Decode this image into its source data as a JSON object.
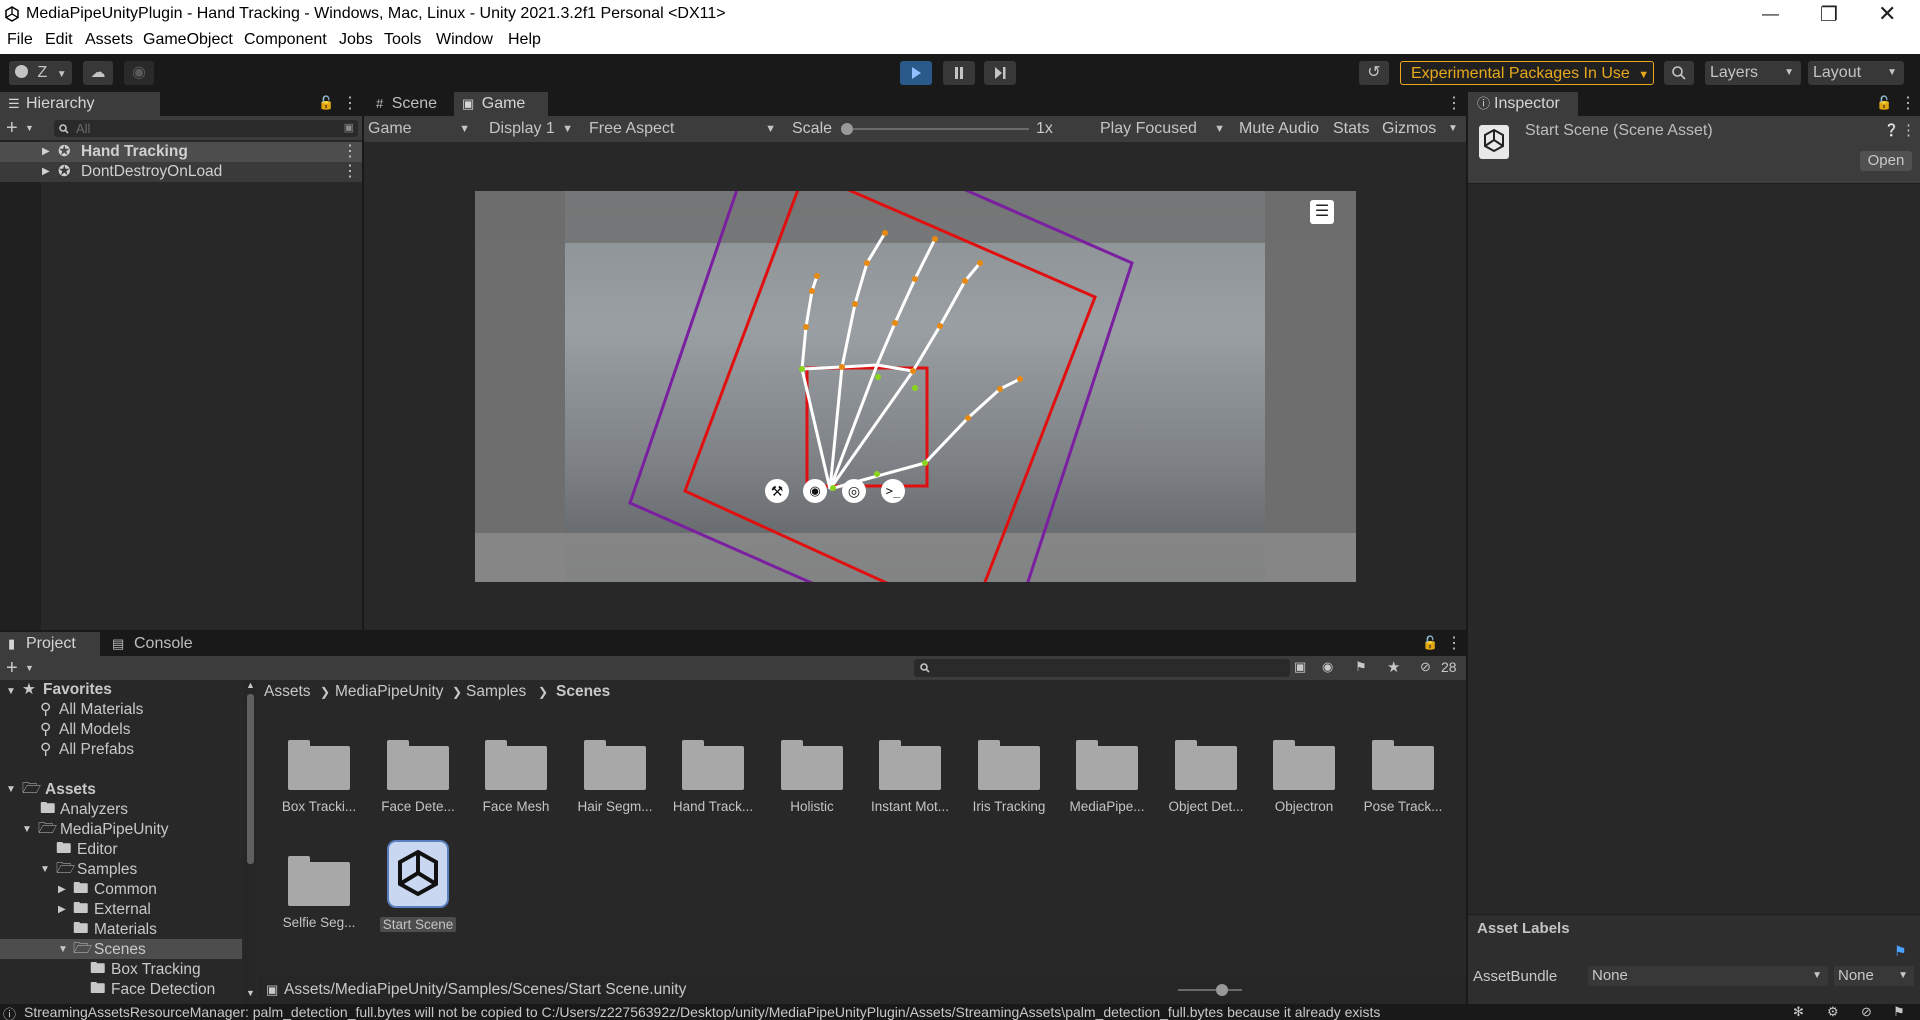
{
  "window": {
    "title": "MediaPipeUnityPlugin - Hand Tracking - Windows, Mac, Linux - Unity 2021.3.2f1 Personal <DX11>"
  },
  "menu": [
    "File",
    "Edit",
    "Assets",
    "GameObject",
    "Component",
    "Jobs",
    "Tools",
    "Window",
    "Help"
  ],
  "toolbar": {
    "account": "Z",
    "experimental": "Experimental Packages In Use",
    "layers": "Layers",
    "layout": "Layout"
  },
  "hierarchy": {
    "tab": "Hierarchy",
    "search_placeholder": "All",
    "items": [
      "Hand Tracking",
      "DontDestroyOnLoad"
    ]
  },
  "game": {
    "tabs": [
      "Scene",
      "Game"
    ],
    "mode": "Game",
    "display": "Display 1",
    "aspect": "Free Aspect",
    "scale_label": "Scale",
    "scale_value": "1x",
    "play_focused": "Play Focused",
    "mute": "Mute Audio",
    "stats": "Stats",
    "gizmos": "Gizmos"
  },
  "inspector": {
    "tab": "Inspector",
    "asset": "Start Scene (Scene Asset)",
    "open": "Open",
    "asset_labels": "Asset Labels",
    "bundle_label": "AssetBundle",
    "bundle_value": "None",
    "variant_value": "None"
  },
  "project": {
    "tabs": [
      "Project",
      "Console"
    ],
    "hidden_count": "28",
    "favorites": "Favorites",
    "favorite_items": [
      "All Materials",
      "All Models",
      "All Prefabs"
    ],
    "assets_root": "Assets",
    "tree": [
      "Analyzers",
      "MediaPipeUnity",
      "Editor",
      "Samples",
      "Common",
      "External",
      "Materials",
      "Scenes",
      "Box Tracking",
      "Face Detection"
    ],
    "breadcrumb": [
      "Assets",
      "MediaPipeUnity",
      "Samples",
      "Scenes"
    ],
    "folders": [
      "Box Tracki...",
      "Face Dete...",
      "Face Mesh",
      "Hair Segm...",
      "Hand Track...",
      "Holistic",
      "Instant Mot...",
      "Iris Tracking",
      "MediaPipe...",
      "Object Det...",
      "Objectron",
      "Pose Track...",
      "Selfie Seg..."
    ],
    "selected_asset": "Start Scene",
    "path": "Assets/MediaPipeUnity/Samples/Scenes/Start Scene.unity"
  },
  "status": "StreamingAssetsResourceManager: palm_detection_full.bytes will not be copied to C:/Users/z22756392z/Desktop/unity/MediaPipeUnityPlugin/Assets/StreamingAssets\\palm_detection_full.bytes because it already exists",
  "colors": {
    "accent": "#e8a81c",
    "play_active": "#2a5a8a",
    "selection": "#4d4d4d"
  }
}
